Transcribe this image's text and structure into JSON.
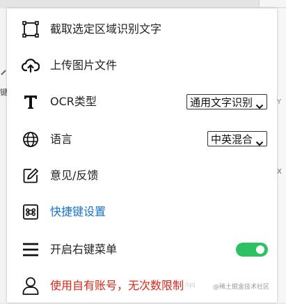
{
  "background": {
    "left_fragment": "键",
    "right_fragment": "X",
    "right_fragment2": "Y"
  },
  "menu": {
    "items": [
      {
        "icon": "crop-selection-icon",
        "label": "截取选定区域识别文字"
      },
      {
        "icon": "cloud-upload-icon",
        "label": "上传图片文件"
      },
      {
        "icon": "text-t-icon",
        "label": "OCR类型",
        "select_value": "通用文字识别"
      },
      {
        "icon": "globe-icon",
        "label": "语言",
        "select_value": "中英混合"
      },
      {
        "icon": "edit-feedback-icon",
        "label": "意见/反馈"
      },
      {
        "icon": "command-key-icon",
        "label": "快捷键设置"
      },
      {
        "icon": "hamburger-menu-icon",
        "label": "开启右键菜单",
        "toggle_on": true
      },
      {
        "icon": "user-icon",
        "label": "使用自有账号，无次数限制"
      }
    ]
  },
  "colors": {
    "link": "#1a73c8",
    "warning": "#d42a1e",
    "toggle_on": "#2ec164"
  },
  "watermark": {
    "text": "@稀土掘金技术社区",
    "faint_text": "/qq"
  }
}
